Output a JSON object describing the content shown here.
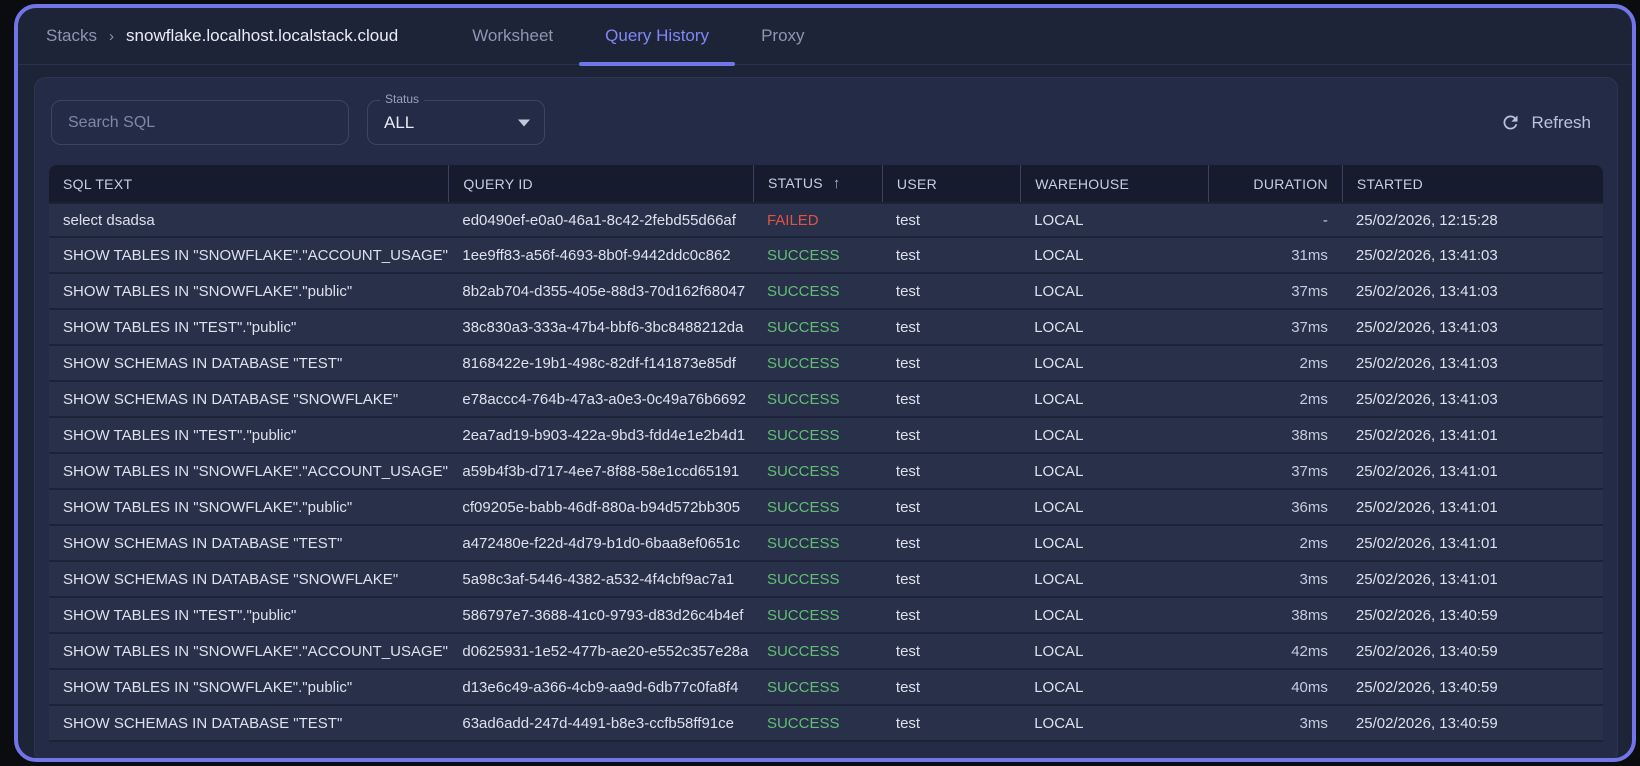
{
  "window": {
    "breadcrumb": {
      "root": "Stacks",
      "separator": "›",
      "current": "snowflake.localhost.localstack.cloud"
    },
    "tabs": [
      {
        "label": "Worksheet",
        "active": false
      },
      {
        "label": "Query History",
        "active": true
      },
      {
        "label": "Proxy",
        "active": false
      }
    ]
  },
  "toolbar": {
    "search": {
      "placeholder": "Search SQL",
      "value": ""
    },
    "status_filter": {
      "label": "Status",
      "value": "ALL"
    },
    "refresh_label": "Refresh"
  },
  "table": {
    "sort": {
      "column_key": "status",
      "direction": "asc",
      "icon": "↑"
    },
    "columns": [
      {
        "key": "sql",
        "label": "SQL TEXT",
        "align": "left"
      },
      {
        "key": "query_id",
        "label": "QUERY ID",
        "align": "left"
      },
      {
        "key": "status",
        "label": "STATUS",
        "align": "left"
      },
      {
        "key": "user",
        "label": "USER",
        "align": "left"
      },
      {
        "key": "warehouse",
        "label": "WAREHOUSE",
        "align": "left"
      },
      {
        "key": "duration",
        "label": "DURATION",
        "align": "right"
      },
      {
        "key": "started",
        "label": "STARTED",
        "align": "left"
      }
    ],
    "rows": [
      {
        "sql": "select dsadsa",
        "query_id": "ed0490ef-e0a0-46a1-8c42-2febd55d66af",
        "status": "FAILED",
        "user": "test",
        "warehouse": "LOCAL",
        "duration": "-",
        "started": "25/02/2026, 12:15:28"
      },
      {
        "sql": "SHOW TABLES IN \"SNOWFLAKE\".\"ACCOUNT_USAGE\"",
        "query_id": "1ee9ff83-a56f-4693-8b0f-9442ddc0c862",
        "status": "SUCCESS",
        "user": "test",
        "warehouse": "LOCAL",
        "duration": "31ms",
        "started": "25/02/2026, 13:41:03"
      },
      {
        "sql": "SHOW TABLES IN \"SNOWFLAKE\".\"public\"",
        "query_id": "8b2ab704-d355-405e-88d3-70d162f68047",
        "status": "SUCCESS",
        "user": "test",
        "warehouse": "LOCAL",
        "duration": "37ms",
        "started": "25/02/2026, 13:41:03"
      },
      {
        "sql": "SHOW TABLES IN \"TEST\".\"public\"",
        "query_id": "38c830a3-333a-47b4-bbf6-3bc8488212da",
        "status": "SUCCESS",
        "user": "test",
        "warehouse": "LOCAL",
        "duration": "37ms",
        "started": "25/02/2026, 13:41:03"
      },
      {
        "sql": "SHOW SCHEMAS IN DATABASE \"TEST\"",
        "query_id": "8168422e-19b1-498c-82df-f141873e85df",
        "status": "SUCCESS",
        "user": "test",
        "warehouse": "LOCAL",
        "duration": "2ms",
        "started": "25/02/2026, 13:41:03"
      },
      {
        "sql": "SHOW SCHEMAS IN DATABASE \"SNOWFLAKE\"",
        "query_id": "e78accc4-764b-47a3-a0e3-0c49a76b6692",
        "status": "SUCCESS",
        "user": "test",
        "warehouse": "LOCAL",
        "duration": "2ms",
        "started": "25/02/2026, 13:41:03"
      },
      {
        "sql": "SHOW TABLES IN \"TEST\".\"public\"",
        "query_id": "2ea7ad19-b903-422a-9bd3-fdd4e1e2b4d1",
        "status": "SUCCESS",
        "user": "test",
        "warehouse": "LOCAL",
        "duration": "38ms",
        "started": "25/02/2026, 13:41:01"
      },
      {
        "sql": "SHOW TABLES IN \"SNOWFLAKE\".\"ACCOUNT_USAGE\"",
        "query_id": "a59b4f3b-d717-4ee7-8f88-58e1ccd65191",
        "status": "SUCCESS",
        "user": "test",
        "warehouse": "LOCAL",
        "duration": "37ms",
        "started": "25/02/2026, 13:41:01"
      },
      {
        "sql": "SHOW TABLES IN \"SNOWFLAKE\".\"public\"",
        "query_id": "cf09205e-babb-46df-880a-b94d572bb305",
        "status": "SUCCESS",
        "user": "test",
        "warehouse": "LOCAL",
        "duration": "36ms",
        "started": "25/02/2026, 13:41:01"
      },
      {
        "sql": "SHOW SCHEMAS IN DATABASE \"TEST\"",
        "query_id": "a472480e-f22d-4d79-b1d0-6baa8ef0651c",
        "status": "SUCCESS",
        "user": "test",
        "warehouse": "LOCAL",
        "duration": "2ms",
        "started": "25/02/2026, 13:41:01"
      },
      {
        "sql": "SHOW SCHEMAS IN DATABASE \"SNOWFLAKE\"",
        "query_id": "5a98c3af-5446-4382-a532-4f4cbf9ac7a1",
        "status": "SUCCESS",
        "user": "test",
        "warehouse": "LOCAL",
        "duration": "3ms",
        "started": "25/02/2026, 13:41:01"
      },
      {
        "sql": "SHOW TABLES IN \"TEST\".\"public\"",
        "query_id": "586797e7-3688-41c0-9793-d83d26c4b4ef",
        "status": "SUCCESS",
        "user": "test",
        "warehouse": "LOCAL",
        "duration": "38ms",
        "started": "25/02/2026, 13:40:59"
      },
      {
        "sql": "SHOW TABLES IN \"SNOWFLAKE\".\"ACCOUNT_USAGE\"",
        "query_id": "d0625931-1e52-477b-ae20-e552c357e28a",
        "status": "SUCCESS",
        "user": "test",
        "warehouse": "LOCAL",
        "duration": "42ms",
        "started": "25/02/2026, 13:40:59"
      },
      {
        "sql": "SHOW TABLES IN \"SNOWFLAKE\".\"public\"",
        "query_id": "d13e6c49-a366-4cb9-aa9d-6db77c0fa8f4",
        "status": "SUCCESS",
        "user": "test",
        "warehouse": "LOCAL",
        "duration": "40ms",
        "started": "25/02/2026, 13:40:59"
      },
      {
        "sql": "SHOW SCHEMAS IN DATABASE \"TEST\"",
        "query_id": "63ad6add-247d-4491-b8e3-ccfb58ff91ce",
        "status": "SUCCESS",
        "user": "test",
        "warehouse": "LOCAL",
        "duration": "3ms",
        "started": "25/02/2026, 13:40:59"
      }
    ]
  },
  "colors": {
    "window_border": "#7175e8",
    "page_bg": "#1e2438",
    "panel_bg": "#242b46",
    "header_bg": "#161b2d",
    "row_bg": "#293049",
    "accent_tab": "#7f87f4",
    "status_failed": "#e05247",
    "status_success": "#63bd77"
  }
}
